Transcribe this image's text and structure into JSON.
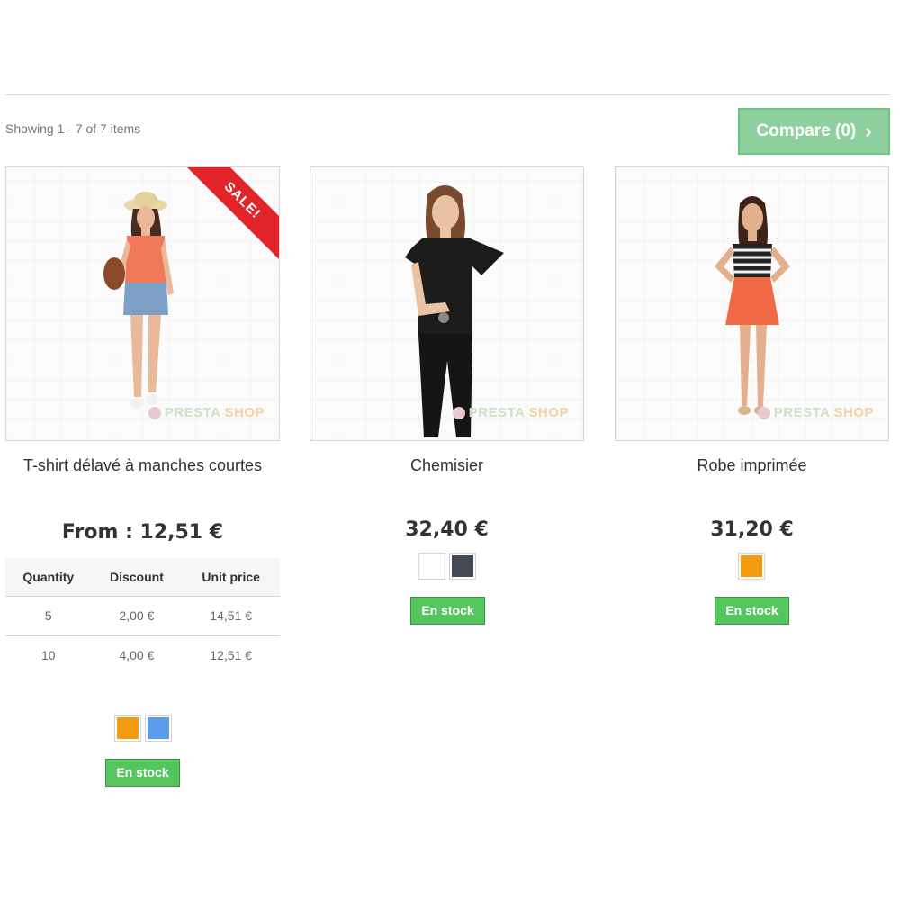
{
  "toolbar": {
    "showing_text": "Showing 1 - 7 of 7 items",
    "compare_label": "Compare (0)"
  },
  "watermark": {
    "presta": "PRESTA",
    "shop": "SHOP"
  },
  "products": [
    {
      "name": "T-shirt délavé à manches courtes",
      "price": "From : 12,51 €",
      "badge": "SALE!",
      "discount_table": {
        "headers": [
          "Quantity",
          "Discount",
          "Unit price"
        ],
        "rows": [
          [
            "5",
            "2,00 €",
            "14,51 €"
          ],
          [
            "10",
            "4,00 €",
            "12,51 €"
          ]
        ]
      },
      "colors": [
        "#f39c11",
        "#5d9cec"
      ],
      "availability": "En stock"
    },
    {
      "name": "Chemisier",
      "price": "32,40 €",
      "colors": [
        "#ffffff",
        "#434a54"
      ],
      "availability": "En stock"
    },
    {
      "name": "Robe imprimée",
      "price": "31,20 €",
      "colors": [
        "#f39c11"
      ],
      "availability": "En stock"
    }
  ]
}
